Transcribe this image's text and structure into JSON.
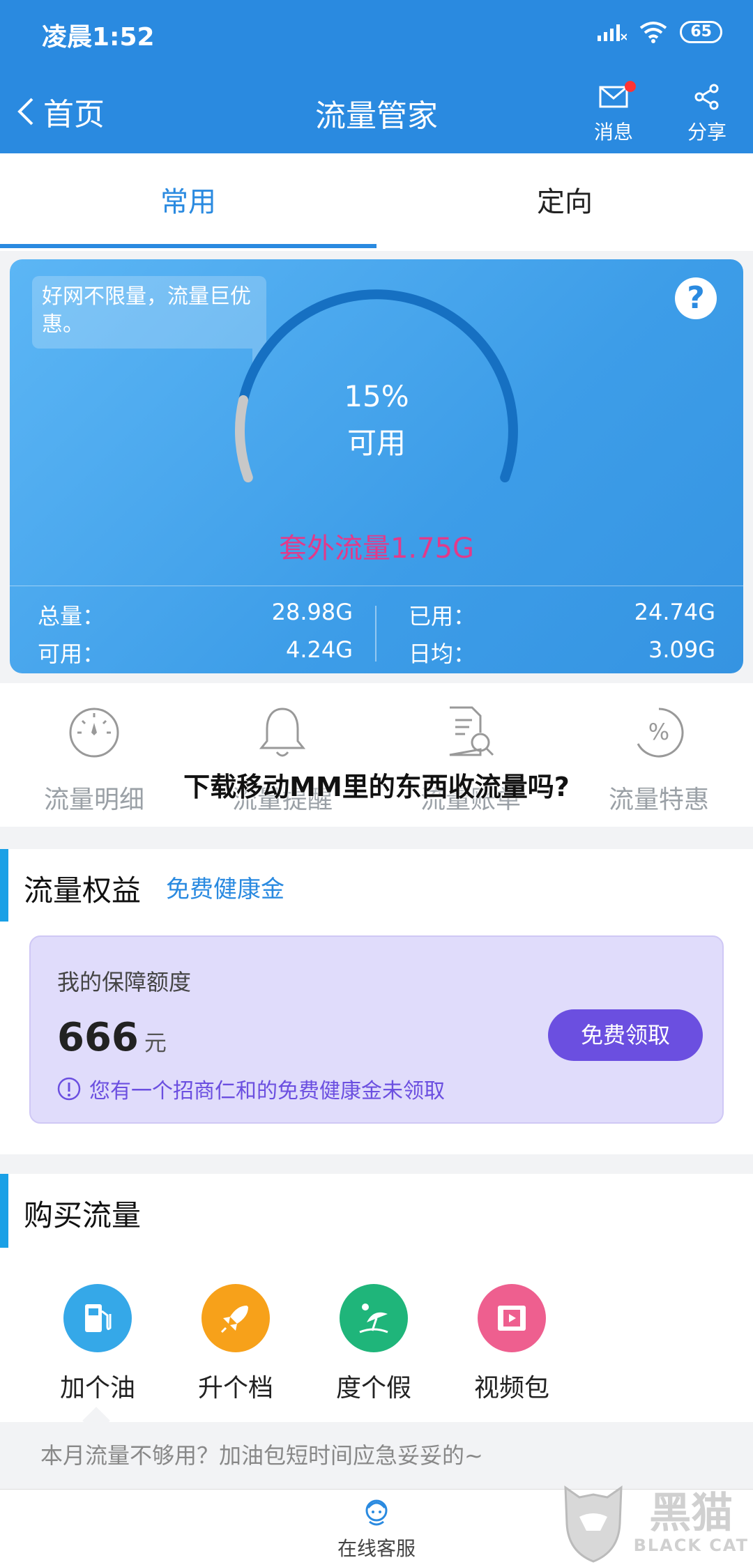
{
  "status_bar": {
    "time": "凌晨1:52",
    "battery": "65"
  },
  "header": {
    "back_label": "首页",
    "title": "流量管家",
    "messages_label": "消息",
    "share_label": "分享"
  },
  "tabs": [
    {
      "label": "常用",
      "active": true
    },
    {
      "label": "定向",
      "active": false
    }
  ],
  "usage_card": {
    "promo_text": "好网不限量，流量巨优惠。",
    "help_glyph": "?",
    "percent": "15%",
    "percent_value": 15,
    "available_label": "可用",
    "extra_traffic": "套外流量1.75G",
    "stats": {
      "total_label": "总量：",
      "total_value": "28.98G",
      "available_label": "可用：",
      "available_value": "4.24G",
      "used_label": "已用：",
      "used_value": "24.74G",
      "daily_label": "日均：",
      "daily_value": "3.09G"
    }
  },
  "quick_actions": [
    {
      "label": "流量明细",
      "icon": "speedometer-icon"
    },
    {
      "label": "流量提醒",
      "icon": "bell-icon"
    },
    {
      "label": "流量账单",
      "icon": "bill-search-icon"
    },
    {
      "label": "流量特惠",
      "icon": "discount-icon"
    }
  ],
  "overlay_title": "下载移动MM里的东西收流量吗?",
  "rights_section": {
    "title": "流量权益",
    "link": "免费健康金",
    "insurance": {
      "title": "我的保障额度",
      "amount": "666",
      "unit": "元",
      "button": "免费领取",
      "note": "您有一个招商仁和的免费健康金未领取"
    }
  },
  "purchase_section": {
    "title": "购买流量",
    "items": [
      {
        "label": "加个油",
        "icon": "fuel-pump-icon",
        "color": "#35a8e8"
      },
      {
        "label": "升个档",
        "icon": "rocket-icon",
        "color": "#f7a11a"
      },
      {
        "label": "度个假",
        "icon": "beach-umbrella-icon",
        "color": "#1fb57a"
      },
      {
        "label": "视频包",
        "icon": "film-icon",
        "color": "#ee5f8f"
      }
    ]
  },
  "tip": "本月流量不够用？加油包短时间应急妥妥的~",
  "bottom_bar": {
    "service_label": "在线客服"
  },
  "watermark": {
    "cn": "黑猫",
    "en": "BLACK CAT"
  },
  "colors": {
    "primary": "#2a8ae0",
    "accent_purple": "#6b4fe0",
    "alert_pink": "#e23a8a"
  }
}
